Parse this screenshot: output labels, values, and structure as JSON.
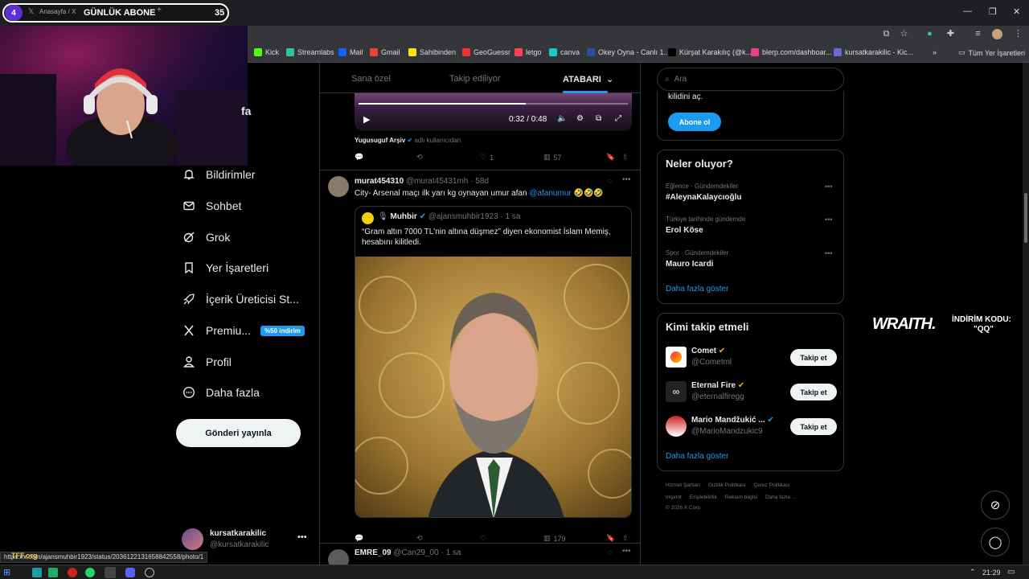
{
  "browser": {
    "tab_title": "Anasayfa / X",
    "bookmarks": [
      {
        "label": "Kick",
        "color": "#53fc18"
      },
      {
        "label": "Streamlabs",
        "color": "#31c3a2"
      },
      {
        "label": "Mail",
        "color": "#0f62fe"
      },
      {
        "label": "Gmail",
        "color": "#ea4335"
      },
      {
        "label": "Sahibinden",
        "color": "#ffe800"
      },
      {
        "label": "GeoGuessr",
        "color": "#e33"
      },
      {
        "label": "letgo",
        "color": "#ff3f55"
      },
      {
        "label": "canva",
        "color": "#20c4cb"
      },
      {
        "label": "Okey Oyna - Canlı 1...",
        "color": "#2b4ea2"
      },
      {
        "label": "Kürşat Karakılıç (@k...",
        "color": "#000"
      },
      {
        "label": "blerp.com/dashboar...",
        "color": "#f03c8c"
      },
      {
        "label": "kursatkarakilic - Kic...",
        "color": "#6a6ad6"
      }
    ],
    "all_bookmarks": "Tüm Yer İşaretleri",
    "status_url": "https://x.com/ajansmuhbir1923/status/2036122131658842558/photo/1"
  },
  "overlay": {
    "sub_count_left": "4",
    "sub_label": "GÜNLÜK ABONE",
    "sub_count_right": "35",
    "sponsor_brand": "WRAITH.",
    "sponsor_code_label": "İNDİRİM KODU:",
    "sponsor_code": "\"QQ\""
  },
  "nav": {
    "partial_label": "fa",
    "items": [
      {
        "label": "Bildirimler",
        "icon": "bell-icon"
      },
      {
        "label": "Sohbet",
        "icon": "envelope-icon"
      },
      {
        "label": "Grok",
        "icon": "grok-icon"
      },
      {
        "label": "Yer İşaretleri",
        "icon": "bookmark-icon"
      },
      {
        "label": "İçerik Üreticisi St...",
        "icon": "rocket-icon"
      },
      {
        "label": "Premiu...",
        "icon": "x-logo-icon"
      },
      {
        "label": "Profil",
        "icon": "person-icon"
      },
      {
        "label": "Daha fazla",
        "icon": "more-circle-icon"
      }
    ],
    "premium_badge": "%50 indirim",
    "post_button": "Gönderi yayınla",
    "account_name": "kursatkarakilic",
    "account_handle": "@kursatkarakilic"
  },
  "feed": {
    "tabs": [
      "Sana özel",
      "Takip ediliyor",
      "ATABARI"
    ],
    "video": {
      "time": "0:32 / 0:48",
      "progress": 0.62
    },
    "prev_post": {
      "source": "Yugusuguf Arşiv",
      "source_suffix": "adlı kullanıcıdan",
      "likes": "1",
      "views": "57"
    },
    "post": {
      "name": "murat454310",
      "handle": "@murat45431mh",
      "time": "58d",
      "text": "City- Arsenal maçı ilk yarı kg oynayan umur afan",
      "mention": "@afanumur",
      "emojis": "🤣🤣🤣",
      "quote": {
        "name": "Muhbir",
        "handle": "@ajansmuhbir1923",
        "time": "1 sa",
        "text": "“Gram altın 7000 TL'nin altına düşmez” diyen ekonomist İslam Memiş, hesabını kilitledi."
      },
      "views": "179"
    },
    "next_post": {
      "name": "EMRE_09",
      "handle": "@Can29_00",
      "time": "1 sa"
    }
  },
  "sidebar": {
    "search_placeholder": "Ara",
    "premium_text": "kilidini aç.",
    "subscribe_button": "Abone ol",
    "trends_title": "Neler oluyor?",
    "trends": [
      {
        "category": "Eğlence · Gündemdekiler",
        "name": "#AleynaKalaycıoğlu"
      },
      {
        "category": "Türkiye tarihinde gündemde",
        "name": "Erol Köse"
      },
      {
        "category": "Spor · Gündemdekiler",
        "name": "Mauro Icardi"
      }
    ],
    "show_more": "Daha fazla göster",
    "who_to_follow_title": "Kimi takip etmeli",
    "suggestions": [
      {
        "name": "Comet",
        "handle": "@Cometml",
        "badge": "#e2b719"
      },
      {
        "name": "Eternal Fire",
        "handle": "@eternalfiregg",
        "badge": "#e2b719"
      },
      {
        "name": "Mario Mandžukić ...",
        "handle": "@MarioMandzukic9",
        "badge": "#1d9bf0"
      }
    ],
    "follow_label": "Takip et",
    "footer": {
      "row1": [
        "Hizmet Şartları",
        "Gizlilik Politikası",
        "Çerez Politikası"
      ],
      "row2": [
        "Imprint",
        "Erişilebilirlik",
        "Reklam bilgisi",
        "Daha fazla ..."
      ],
      "copyright": "© 2026 X Corp."
    }
  },
  "taskbar": {
    "clock": "21:29",
    "overlay_text": "TFF.org"
  }
}
